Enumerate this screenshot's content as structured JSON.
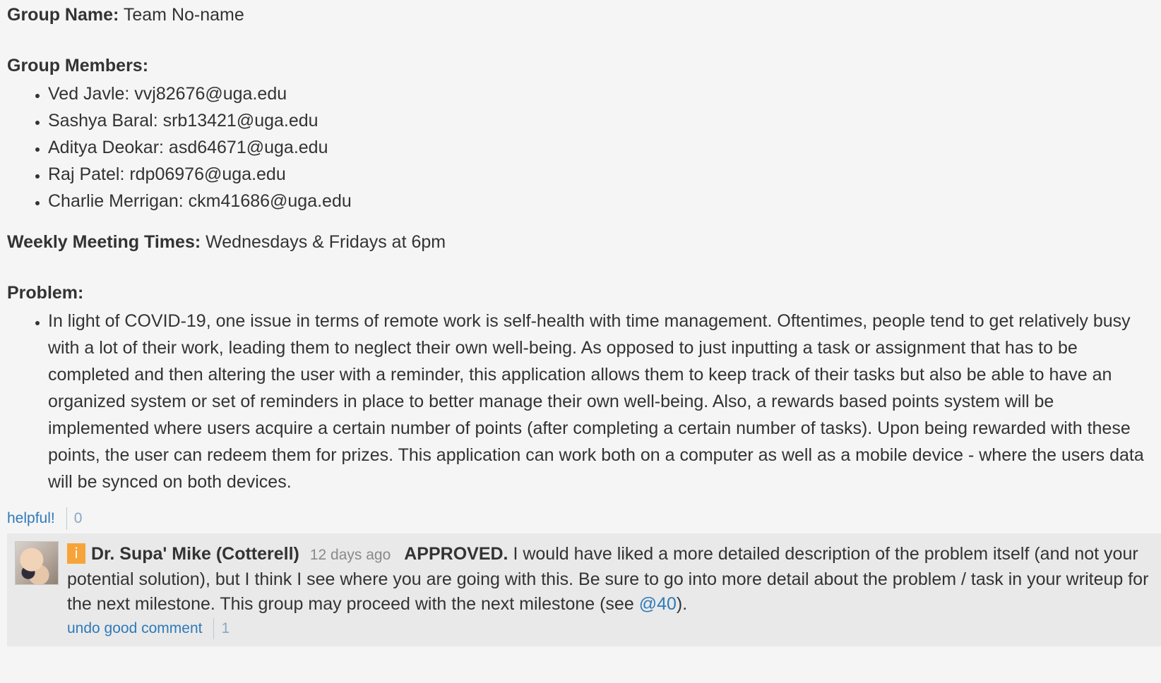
{
  "post": {
    "group_name_label": "Group Name:",
    "group_name_value": "Team No-name",
    "members_label": "Group Members:",
    "members": [
      "Ved Javle: vvj82676@uga.edu",
      "Sashya Baral: srb13421@uga.edu",
      "Aditya Deokar: asd64671@uga.edu",
      "Raj Patel: rdp06976@uga.edu",
      "Charlie Merrigan: ckm41686@uga.edu"
    ],
    "meeting_label": "Weekly Meeting Times:",
    "meeting_value": "Wednesdays & Fridays at 6pm",
    "problem_label": "Problem:",
    "problem_text": "In light of COVID-19, one issue in terms of remote work is self-health with time management. Oftentimes, people tend to get relatively busy with a lot of their work, leading them to neglect their own well-being. As opposed to just inputting a task or assignment that has to be completed and then altering the user with a reminder, this application allows them to keep track of their tasks but also be able to have an organized system or set of reminders in place to better manage their own well-being. Also, a rewards based points system will be implemented where users acquire a certain number of points (after completing a certain number of tasks). Upon being rewarded with these points, the user can redeem them for prizes. This application can work both on a computer as well as a mobile device - where the users data will be synced on both devices."
  },
  "helpful": {
    "label": "helpful!",
    "count": "0"
  },
  "followup": {
    "badge": "i",
    "author": "Dr. Supa' Mike (Cotterell)",
    "timestamp": "12 days ago",
    "approved": "APPROVED.",
    "text_before_link": "I would have liked a more detailed description of the problem itself (and not your potential solution), but I think I see where you are going with this. Be sure to go into more detail about the problem / task in your writeup for the next milestone. This group may proceed with the next milestone (see",
    "link_text": "@40",
    "text_after_link": ").",
    "good_comment_label": "undo good comment",
    "good_comment_count": "1"
  },
  "colors": {
    "background": "#f5f5f5",
    "followup_background": "#e9e9e9",
    "link": "#2f7ab9",
    "instructor_badge": "#f6a43a"
  }
}
